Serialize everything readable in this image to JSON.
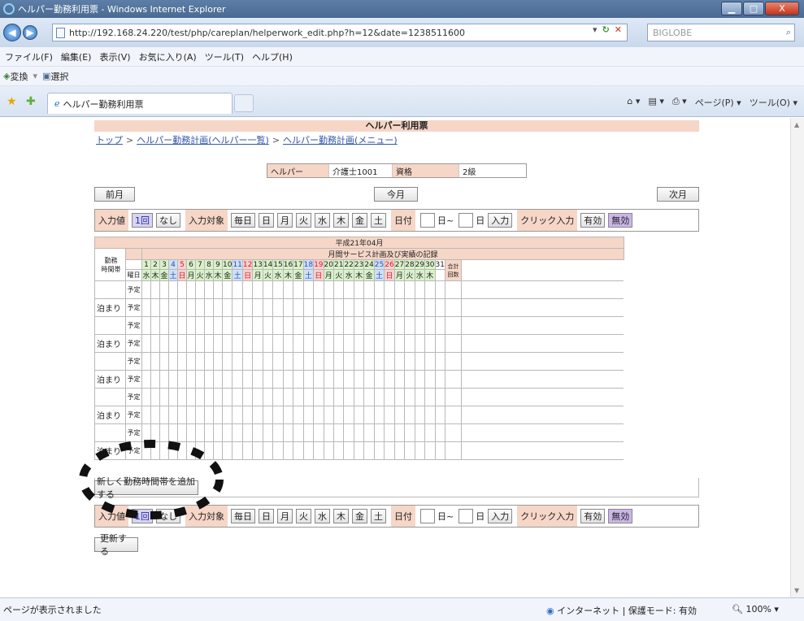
{
  "window": {
    "title": "ヘルパー勤務利用票 - Windows Internet Explorer",
    "minimize": "▁",
    "maximize": "□",
    "close": "X"
  },
  "address_bar": {
    "url": "http://192.168.24.220/test/php/careplan/helperwork_edit.php?h=12&date=1238511600",
    "search_placeholder": "BIGLOBE"
  },
  "menu": [
    "ファイル(F)",
    "編集(E)",
    "表示(V)",
    "お気に入り(A)",
    "ツール(T)",
    "ヘルプ(H)"
  ],
  "command_bar": {
    "convert": "変換",
    "select": "選択"
  },
  "tab": {
    "title": "ヘルパー勤務利用票",
    "page_menu": "ページ(P)",
    "tools_menu": "ツール(O)"
  },
  "page": {
    "header": "ヘルパー利用票",
    "breadcrumb": [
      "トップ",
      "ヘルパー勤務計画(ヘルパー一覧)",
      "ヘルパー勤務計画(メニュー)"
    ],
    "helper": {
      "helper_label": "ヘルパー",
      "helper_value": "介護士1001",
      "qual_label": "資格",
      "qual_value": "2級"
    },
    "prev_month": "前月",
    "this_month": "今月",
    "next_month": "次月",
    "input_bar": {
      "value_label": "入力値",
      "once": "1回",
      "none": "なし",
      "target_label": "入力対象",
      "every_day": "毎日",
      "weekdays": [
        "日",
        "月",
        "火",
        "水",
        "木",
        "金",
        "土"
      ],
      "date_label": "日付",
      "from_suffix": "日~",
      "to_suffix": "日",
      "input_btn": "入力",
      "click_label": "クリック入力",
      "enable": "有効",
      "disable": "無効"
    },
    "schedule": {
      "month_title": "平成21年04月",
      "subtitle": "月間サービス計画及び実績の記録",
      "time_slot_label": "勤務\n時間帯",
      "weekday_row_label": "曜日",
      "total_label": "合計回数",
      "days": [
        1,
        2,
        3,
        4,
        5,
        6,
        7,
        8,
        9,
        10,
        11,
        12,
        13,
        14,
        15,
        16,
        17,
        18,
        19,
        20,
        21,
        22,
        23,
        24,
        25,
        26,
        27,
        28,
        29,
        30,
        31
      ],
      "weekday_of_day": [
        "水",
        "木",
        "金",
        "土",
        "日",
        "月",
        "火",
        "水",
        "木",
        "金",
        "土",
        "日",
        "月",
        "火",
        "水",
        "木",
        "金",
        "土",
        "日",
        "月",
        "火",
        "水",
        "木",
        "金",
        "土",
        "日",
        "月",
        "火",
        "水",
        "木",
        ""
      ],
      "plan_label": "予定",
      "slot_label": "泊まり",
      "slots": 5
    },
    "add_slot_button": "新しく勤務時間帯を追加する",
    "update_button": "更新する"
  },
  "status": {
    "text": "ページが表示されました",
    "zone": "インターネット | 保護モード: 有効",
    "zoom": "100%"
  }
}
